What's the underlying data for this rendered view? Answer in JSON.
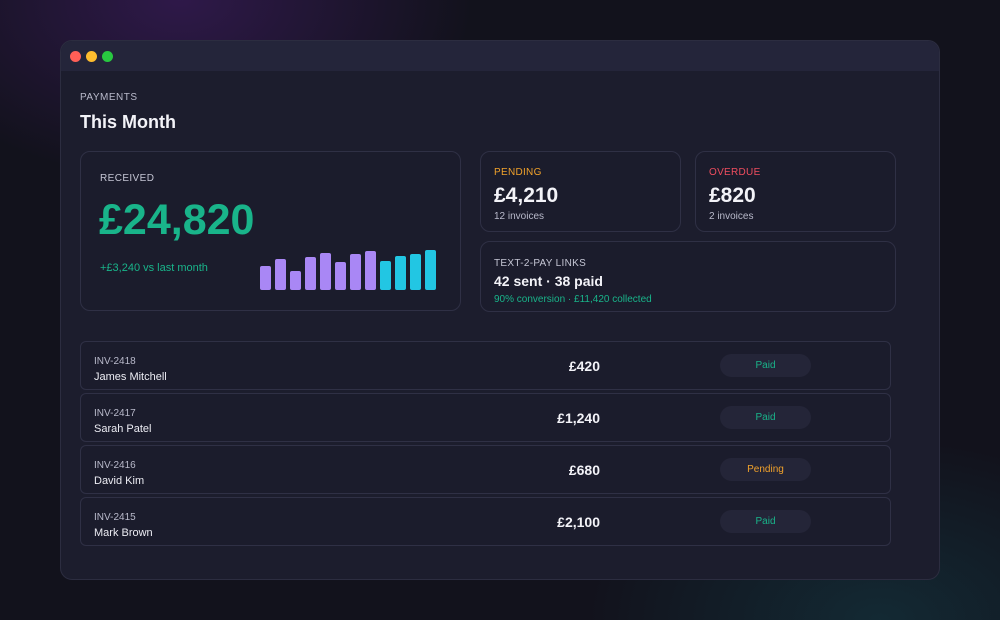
{
  "page": {
    "eyebrow": "PAYMENTS",
    "title": "This Month"
  },
  "received": {
    "label": "RECEIVED",
    "amount": "£24,820",
    "delta": "+£3,240 vs last month",
    "sparkline_values": [
      0.6,
      0.78,
      0.47,
      0.82,
      0.92,
      0.7,
      0.9,
      0.97,
      0.72,
      0.85,
      0.9,
      1.0
    ],
    "bar_colors": [
      "#a987f5",
      "#a987f5",
      "#a987f5",
      "#a987f5",
      "#a987f5",
      "#a987f5",
      "#a987f5",
      "#a987f5",
      "#22c6e3",
      "#22c6e3",
      "#22c6e3",
      "#22c6e3"
    ]
  },
  "pending": {
    "label": "PENDING",
    "value": "£4,210",
    "sub": "12 invoices"
  },
  "overdue": {
    "label": "OVERDUE",
    "value": "£820",
    "sub": "2 invoices"
  },
  "text2pay": {
    "label": "TEXT-2-PAY LINKS",
    "value": "42 sent · 38 paid",
    "sub": "90% conversion · £11,420 collected"
  },
  "invoices": [
    {
      "id": "INV-2418",
      "name": "James Mitchell",
      "amount": "£420",
      "status": "Paid"
    },
    {
      "id": "INV-2417",
      "name": "Sarah Patel",
      "amount": "£1,240",
      "status": "Paid"
    },
    {
      "id": "INV-2416",
      "name": "David Kim",
      "amount": "£680",
      "status": "Pending"
    },
    {
      "id": "INV-2415",
      "name": "Mark Brown",
      "amount": "£2,100",
      "status": "Paid"
    }
  ],
  "colors": {
    "accent_green": "#19b48a",
    "pending_orange": "#f0a12b",
    "overdue_red": "#ef4d5f",
    "bar_purple": "#a987f5",
    "bar_cyan": "#22c6e3"
  }
}
